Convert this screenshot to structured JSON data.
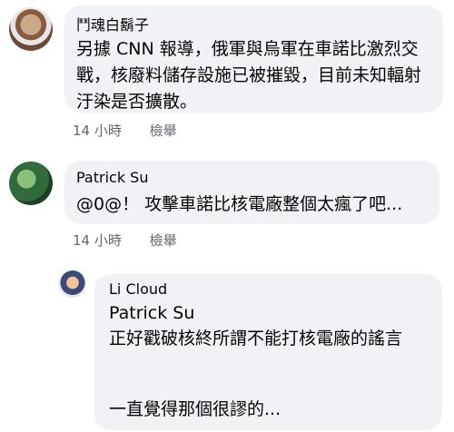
{
  "comments": [
    {
      "author": "鬥魂白鬍子",
      "text": "另據 CNN 報導，俄軍與烏軍在車諾比激烈交戰，核廢料儲存設施已被摧毀，目前未知輻射汙染是否擴散。",
      "time": "14 小時",
      "report": "檢舉"
    },
    {
      "author": "Patrick Su",
      "text": "@0@！ 攻擊車諾比核電廠整個太瘋了吧...",
      "time": "14 小時",
      "report": "檢舉"
    }
  ],
  "reply": {
    "author": "Li Cloud",
    "mention": "Patrick Su",
    "text_line": "正好戳破核終所謂不能打核電廠的謠言",
    "text_last": "一直覺得那個很謬的..."
  }
}
